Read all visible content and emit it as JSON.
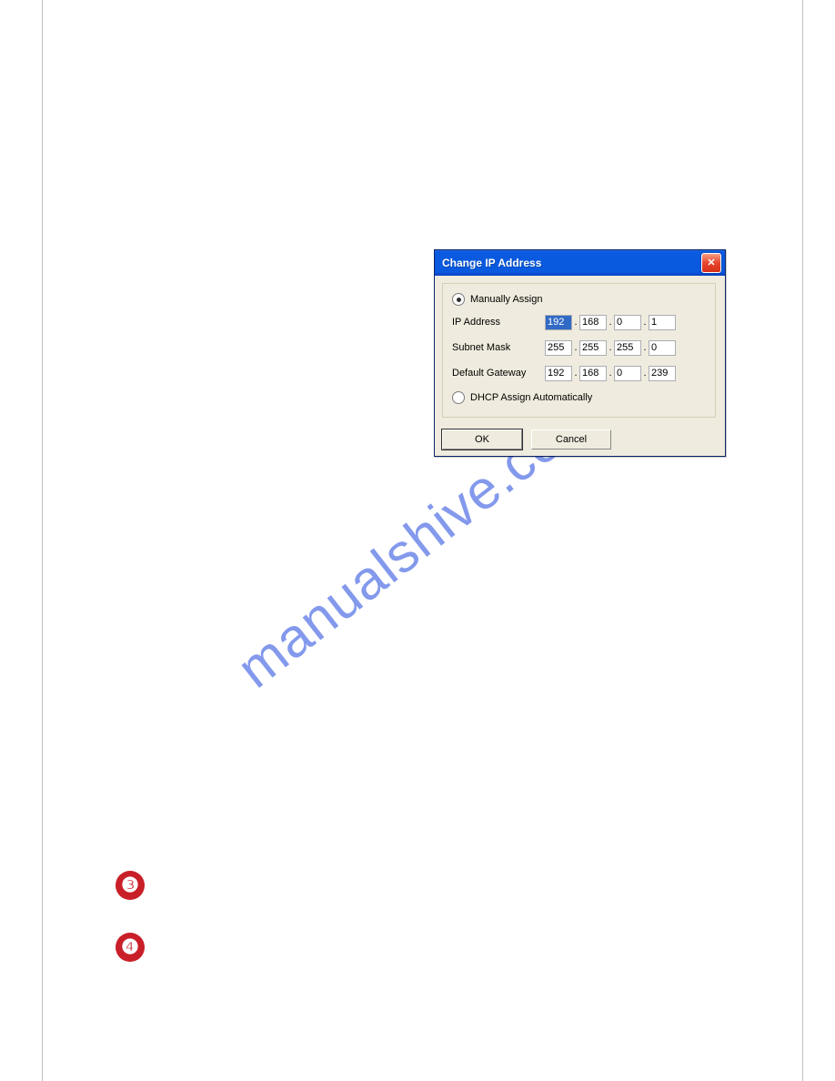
{
  "watermark": "manualshive.com",
  "dialog": {
    "title": "Change IP Address",
    "radio_manual": "Manually Assign",
    "radio_dhcp": "DHCP Assign Automatically",
    "rows": {
      "ip": {
        "label": "IP Address",
        "o1": "192",
        "o2": "168",
        "o3": "0",
        "o4": "1"
      },
      "mask": {
        "label": "Subnet Mask",
        "o1": "255",
        "o2": "255",
        "o3": "255",
        "o4": "0"
      },
      "gateway": {
        "label": "Default Gateway",
        "o1": "192",
        "o2": "168",
        "o3": "0",
        "o4": "239"
      }
    },
    "buttons": {
      "ok": "OK",
      "cancel": "Cancel"
    }
  },
  "badges": {
    "three": "❸",
    "four": "❹"
  }
}
